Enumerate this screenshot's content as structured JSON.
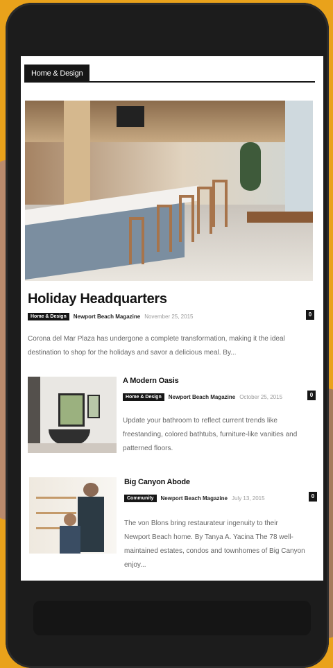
{
  "section": {
    "label": "Home & Design"
  },
  "featured": {
    "title": "Holiday Headquarters",
    "category": "Home & Design",
    "author": "Newport Beach Magazine",
    "date": "November 25, 2015",
    "comments": "0",
    "excerpt_lines": [
      "Corona del Mar Plaza has undergone a complete transformation, making it the ideal",
      "destination to shop for the holidays and savor a delicious meal. By..."
    ]
  },
  "articles": [
    {
      "title": "A Modern Oasis",
      "category": "Home & Design",
      "author": "Newport Beach Magazine",
      "date": "October 25, 2015",
      "comments": "0",
      "excerpt_lines": [
        "Update your bathroom to reflect current trends like",
        "freestanding, colored bathtubs, furniture-like vanities and",
        "patterned floors."
      ]
    },
    {
      "title": "Big Canyon Abode",
      "category": "Community",
      "author": "Newport Beach Magazine",
      "date": "July 13, 2015",
      "comments": "0",
      "excerpt_lines": [
        "The von Blons bring restaurateur ingenuity to their",
        "Newport Beach home. By Tanya A. Yacina   The 78 well-",
        "maintained estates, condos and townhomes of Big Canyon",
        "enjoy..."
      ]
    }
  ]
}
